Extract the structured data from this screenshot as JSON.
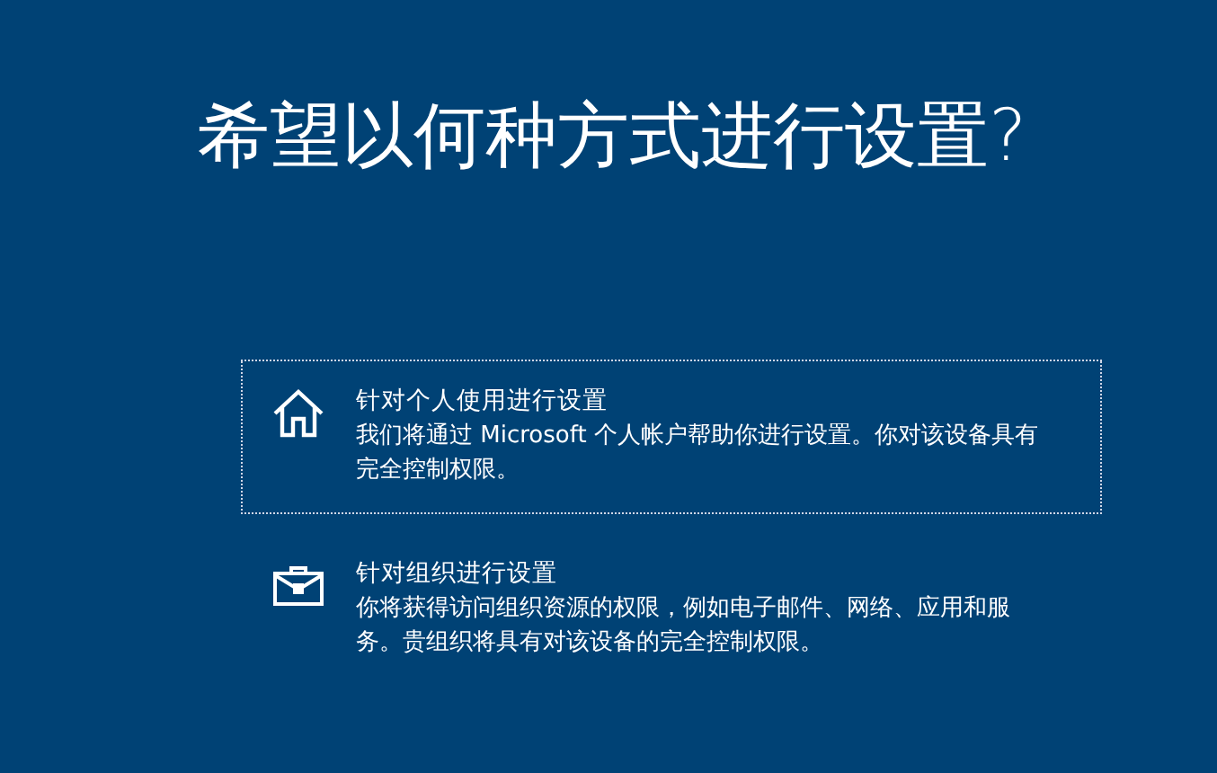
{
  "title": "希望以何种方式进行设置?",
  "options": [
    {
      "kind": "home",
      "title": "针对个人使用进行设置",
      "description": "我们将通过 Microsoft 个人帐户帮助你进行设置。你对该设备具有完全控制权限。",
      "selected": true
    },
    {
      "kind": "work",
      "title": "针对组织进行设置",
      "description": "你将获得访问组织资源的权限，例如电子邮件、网络、应用和服务。贵组织将具有对该设备的完全控制权限。",
      "selected": false
    }
  ]
}
